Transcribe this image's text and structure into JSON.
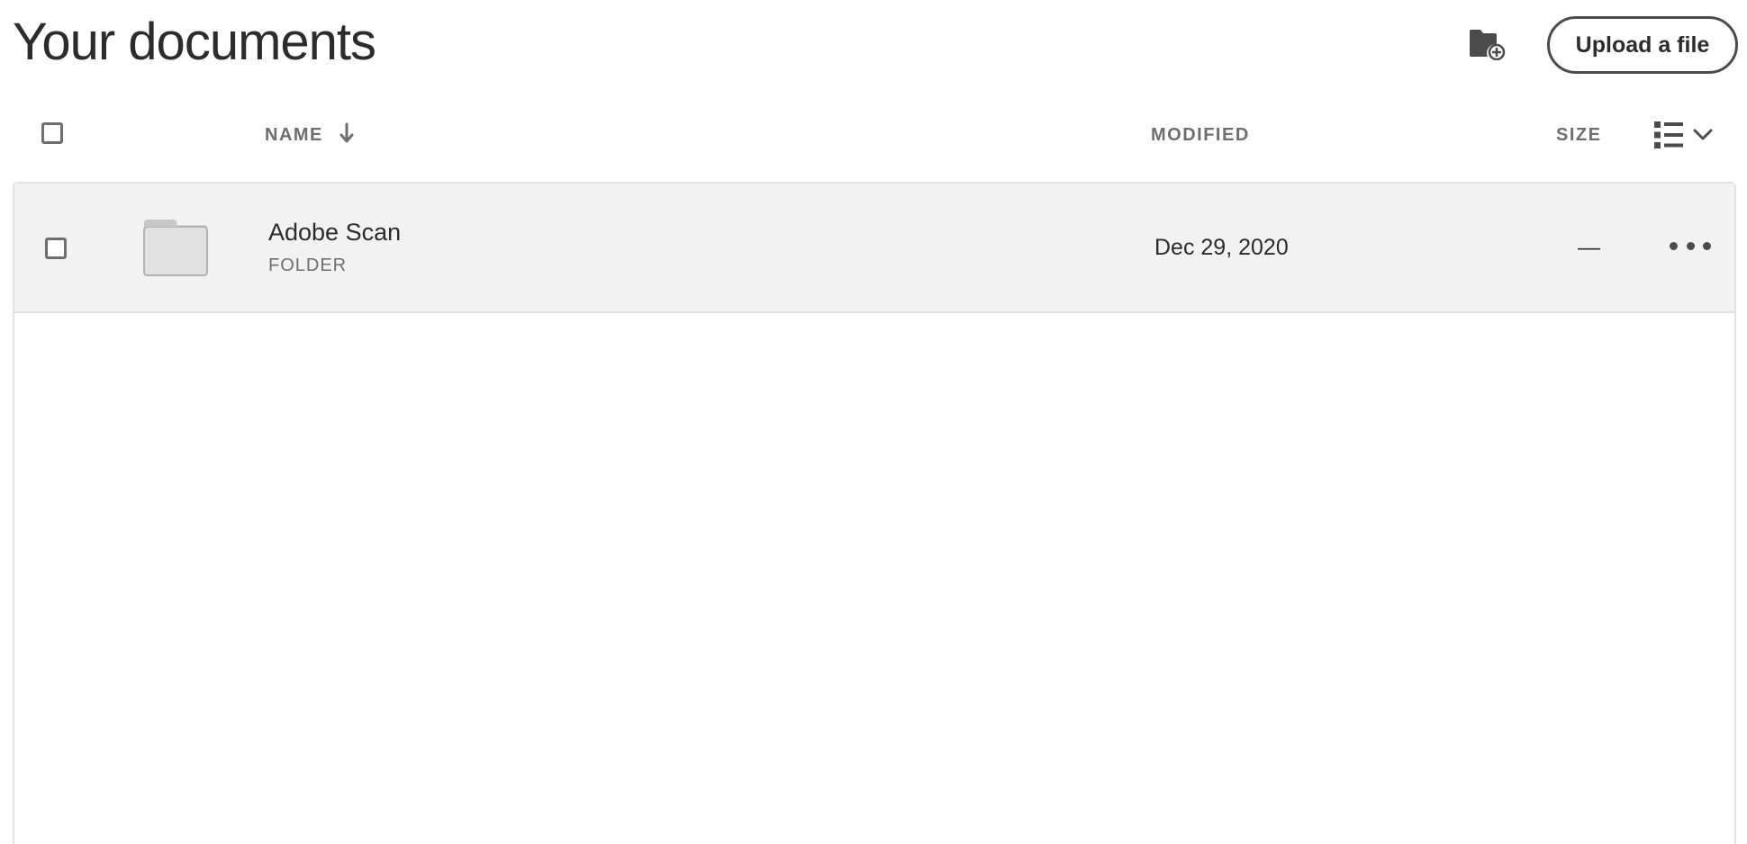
{
  "header": {
    "title": "Your documents",
    "new_folder_icon": "folder-add-icon",
    "upload_label": "Upload a file"
  },
  "columns": {
    "name": "NAME",
    "name_sort": "descending",
    "modified": "MODIFIED",
    "size": "SIZE",
    "view_icon": "list-view-icon"
  },
  "files": [
    {
      "name": "Adobe Scan",
      "type": "FOLDER",
      "modified": "Dec 29, 2020",
      "size": "—",
      "icon": "folder-icon"
    }
  ],
  "colors": {
    "row_background": "#f2f2f2",
    "border": "#e1e1e1",
    "text_primary": "#2c2c2c",
    "text_secondary": "#6e6e6e"
  }
}
